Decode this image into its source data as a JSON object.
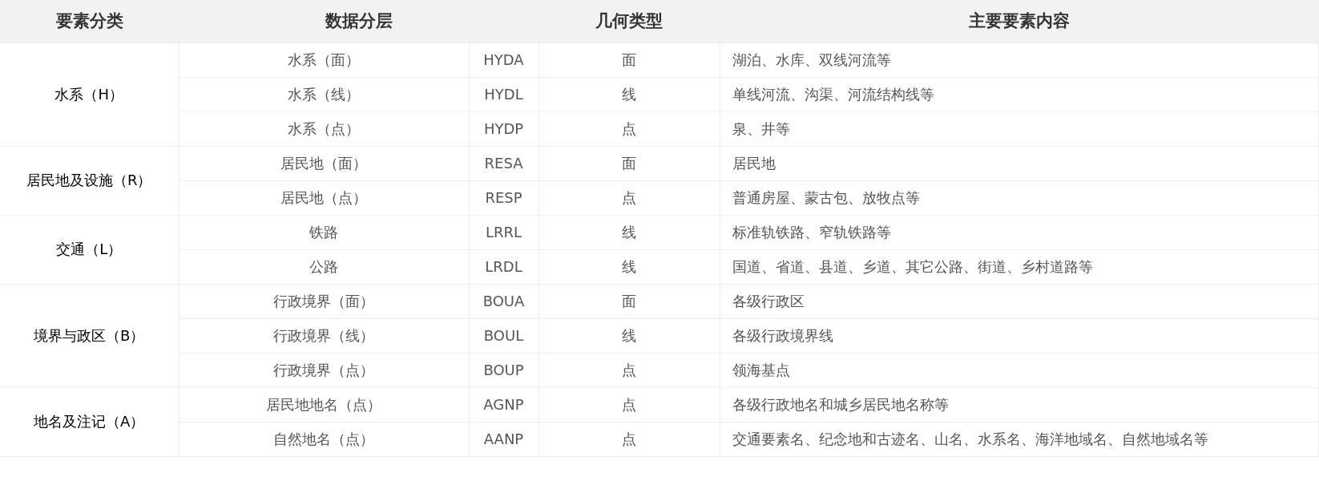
{
  "table": {
    "columns": [
      "要素分类",
      "数据分层",
      "几何类型",
      "主要要素内容"
    ],
    "groups": [
      {
        "category": "水系（H）",
        "layers": [
          {
            "name": "水系（面）",
            "code": "HYDA",
            "geometry": "面",
            "content": "湖泊、水库、双线河流等"
          },
          {
            "name": "水系（线）",
            "code": "HYDL",
            "geometry": "线",
            "content": "单线河流、沟渠、河流结构线等"
          },
          {
            "name": "水系（点）",
            "code": "HYDP",
            "geometry": "点",
            "content": "泉、井等"
          }
        ]
      },
      {
        "category": "居民地及设施（R）",
        "layers": [
          {
            "name": "居民地（面）",
            "code": "RESA",
            "geometry": "面",
            "content": "居民地"
          },
          {
            "name": "居民地（点）",
            "code": "RESP",
            "geometry": "点",
            "content": "普通房屋、蒙古包、放牧点等"
          }
        ]
      },
      {
        "category": "交通（L）",
        "layers": [
          {
            "name": "铁路",
            "code": "LRRL",
            "geometry": "线",
            "content": "标准轨铁路、窄轨铁路等"
          },
          {
            "name": "公路",
            "code": "LRDL",
            "geometry": "线",
            "content": "国道、省道、县道、乡道、其它公路、街道、乡村道路等"
          }
        ]
      },
      {
        "category": "境界与政区（B）",
        "layers": [
          {
            "name": "行政境界（面）",
            "code": "BOUA",
            "geometry": "面",
            "content": "各级行政区"
          },
          {
            "name": "行政境界（线）",
            "code": "BOUL",
            "geometry": "线",
            "content": "各级行政境界线"
          },
          {
            "name": "行政境界（点）",
            "code": "BOUP",
            "geometry": "点",
            "content": "领海基点"
          }
        ]
      },
      {
        "category": "地名及注记（A）",
        "layers": [
          {
            "name": "居民地地名（点）",
            "code": "AGNP",
            "geometry": "点",
            "content": "各级行政地名和城乡居民地名称等"
          },
          {
            "name": "自然地名（点）",
            "code": "AANP",
            "geometry": "点",
            "content": "交通要素名、纪念地和古迹名、山名、水系名、海洋地域名、自然地域名等"
          }
        ]
      }
    ]
  }
}
